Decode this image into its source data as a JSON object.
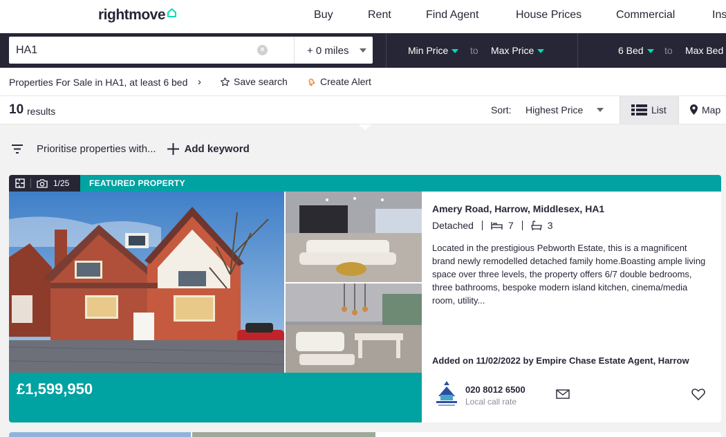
{
  "brand": {
    "name": "rightmove",
    "accent": "#00deb6",
    "dark": "#262637",
    "teal": "#00a2a2"
  },
  "nav": {
    "items": [
      "Buy",
      "Rent",
      "Find Agent",
      "House Prices",
      "Commercial",
      "Ins"
    ]
  },
  "search": {
    "location": "HA1",
    "radius": "+ 0 miles",
    "min_price": "Min Price",
    "to1": "to",
    "max_price": "Max Price",
    "min_beds": "6 Bed",
    "to2": "to",
    "max_beds": "Max Bed"
  },
  "breadcrumb": {
    "text": "Properties For Sale in HA1, at least 6 bed",
    "save_search": "Save search",
    "create_alert": "Create Alert"
  },
  "results": {
    "count": "10",
    "label": "results",
    "sort_label": "Sort:",
    "sort_value": "Highest Price",
    "list_label": "List",
    "map_label": "Map"
  },
  "prioritise": {
    "text": "Prioritise properties with...",
    "add_keyword": "Add keyword"
  },
  "listing": {
    "photo_count": "1/25",
    "featured_label": "FEATURED PROPERTY",
    "price": "£1,599,950",
    "address": "Amery Road, Harrow, Middlesex, HA1",
    "type": "Detached",
    "bedrooms": "7",
    "bathrooms": "3",
    "description": "Located in the prestigious Pebworth Estate, this is a magnificent brand newly remodelled detached family home.Boasting ample living space over three levels, the property offers 6/7 double bedrooms, three bathrooms, bespoke modern island kitchen, cinema/media room, utility...",
    "added": "Added on 11/02/2022 by Empire Chase Estate Agent, Harrow",
    "phone": "020 8012 6500",
    "call_rate": "Local call rate"
  }
}
